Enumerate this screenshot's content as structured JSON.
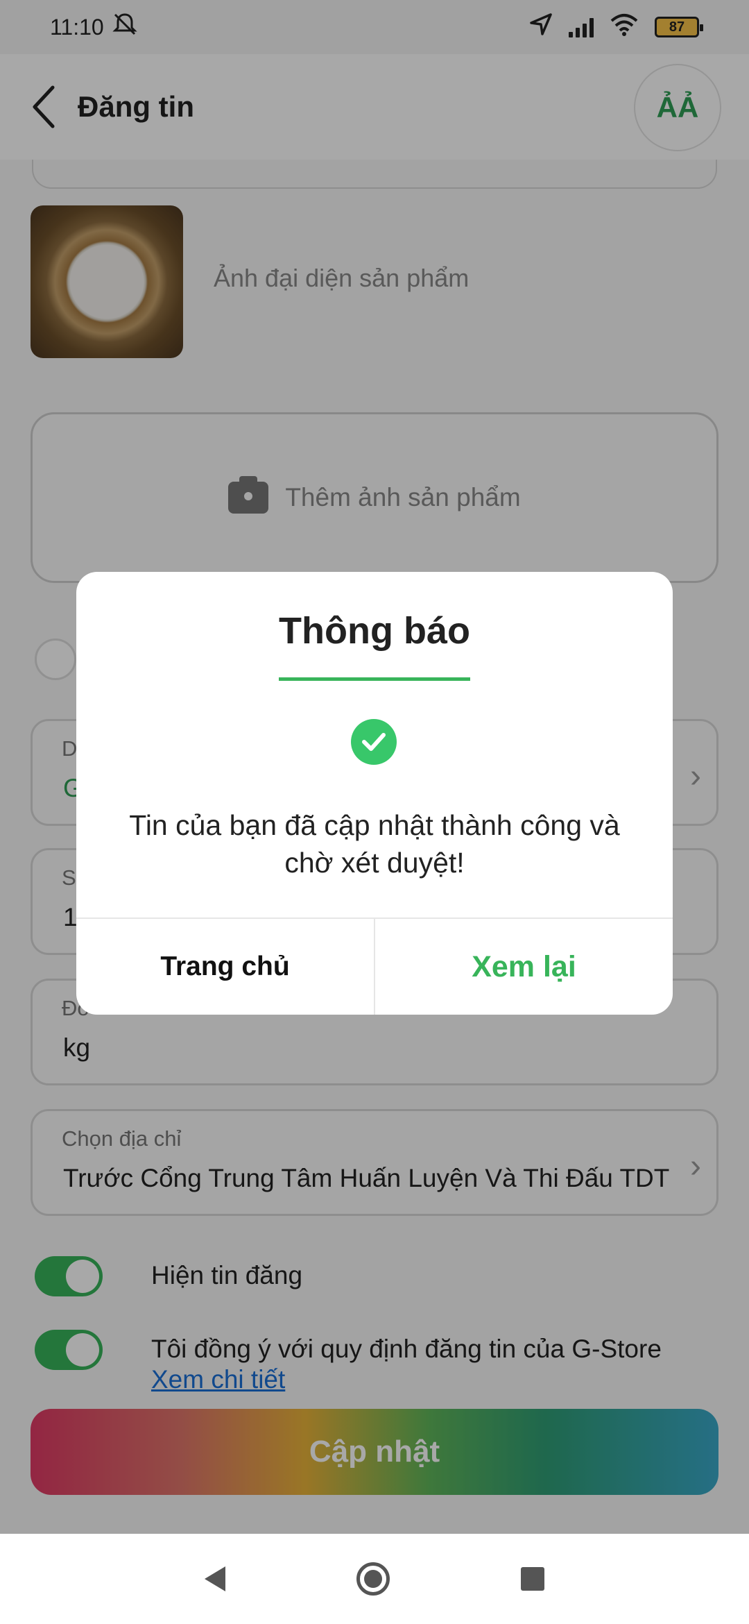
{
  "status_bar": {
    "time": "11:10",
    "battery": "87",
    "icons": [
      "mute-icon",
      "location-icon",
      "signal-icon",
      "wifi-icon",
      "battery-icon"
    ]
  },
  "header": {
    "back_icon": "chevron-left-icon",
    "title": "Đăng tin",
    "font_button_label": "ẢẢ"
  },
  "form": {
    "thumbnail_label": "Ảnh đại diện sản phẩm",
    "add_photo_label": "Thêm ảnh sản phẩm",
    "fields": [
      {
        "label": "D",
        "value": "G"
      },
      {
        "label": "S",
        "value": "1"
      },
      {
        "label": "Đơ",
        "value": "kg"
      },
      {
        "label": "Chọn địa chỉ",
        "value": "Trước Cổng Trung Tâm Huấn Luyện Và Thi Đấu TDT"
      }
    ],
    "toggles": [
      {
        "label": "Hiện tin đăng",
        "on": true
      },
      {
        "label": "Tôi đồng ý với quy định đăng tin của G-Store",
        "link": "Xem chi tiết",
        "on": true
      }
    ],
    "submit_label": "Cập nhật"
  },
  "dialog": {
    "title": "Thông báo",
    "message": "Tin của bạn đã cập nhật thành công và chờ xét duyệt!",
    "buttons": {
      "home": "Trang chủ",
      "review": "Xem lại"
    },
    "accent_color": "#38b45a"
  }
}
